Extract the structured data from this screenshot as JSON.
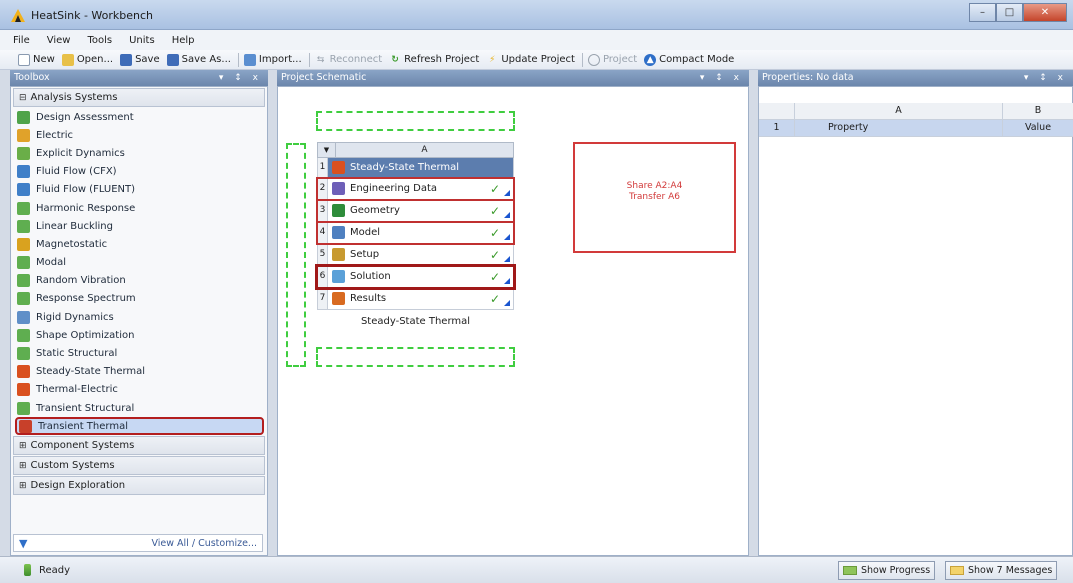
{
  "window": {
    "title": "HeatSink - Workbench"
  },
  "menu": [
    "File",
    "View",
    "Tools",
    "Units",
    "Help"
  ],
  "toolbar": {
    "new": "New",
    "open": "Open...",
    "save": "Save",
    "save_as": "Save As...",
    "import": "Import...",
    "reconnect": "Reconnect",
    "refresh": "Refresh Project",
    "update": "Update Project",
    "project": "Project",
    "compact": "Compact Mode"
  },
  "toolbox": {
    "title": "Toolbox",
    "controls": "▾ ↕ x",
    "analysis_header": "Analysis Systems",
    "items": [
      {
        "label": "Design Assessment",
        "color": "#4fa34a"
      },
      {
        "label": "Electric",
        "color": "#e0a22a"
      },
      {
        "label": "Explicit Dynamics",
        "color": "#6aae48"
      },
      {
        "label": "Fluid Flow (CFX)",
        "color": "#3f7fc8"
      },
      {
        "label": "Fluid Flow (FLUENT)",
        "color": "#3f7fc8"
      },
      {
        "label": "Harmonic Response",
        "color": "#5fae50"
      },
      {
        "label": "Linear Buckling",
        "color": "#5fae50"
      },
      {
        "label": "Magnetostatic",
        "color": "#d9a21f"
      },
      {
        "label": "Modal",
        "color": "#5fae50"
      },
      {
        "label": "Random Vibration",
        "color": "#5fae50"
      },
      {
        "label": "Response Spectrum",
        "color": "#5fae50"
      },
      {
        "label": "Rigid Dynamics",
        "color": "#5f8fc8"
      },
      {
        "label": "Shape Optimization",
        "color": "#5fae50"
      },
      {
        "label": "Static Structural",
        "color": "#5fae50"
      },
      {
        "label": "Steady-State Thermal",
        "color": "#d9501f"
      },
      {
        "label": "Thermal-Electric",
        "color": "#d9501f"
      },
      {
        "label": "Transient Structural",
        "color": "#5fae50"
      },
      {
        "label": "Transient Thermal",
        "color": "#c8402a"
      }
    ],
    "sections": [
      "Component Systems",
      "Custom Systems",
      "Design Exploration"
    ],
    "view_all": "View All / Customize..."
  },
  "schematic": {
    "title": "Project Schematic",
    "column": "A",
    "system_title": "Steady-State Thermal",
    "rows": [
      {
        "num": "2",
        "label": "Engineering Data",
        "color": "#6e5fb8"
      },
      {
        "num": "3",
        "label": "Geometry",
        "color": "#2e8c3a"
      },
      {
        "num": "4",
        "label": "Model",
        "color": "#4f80c0"
      },
      {
        "num": "5",
        "label": "Setup",
        "color": "#c89a30"
      },
      {
        "num": "6",
        "label": "Solution",
        "color": "#5aa0d8"
      },
      {
        "num": "7",
        "label": "Results",
        "color": "#d86a20"
      }
    ],
    "header_num": "1",
    "caption": "Steady-State Thermal",
    "note_line1": "Share A2:A4",
    "note_line2": "Transfer A6"
  },
  "properties": {
    "title": "Properties: No data",
    "col_a": "A",
    "col_b": "B",
    "row_num": "1",
    "row_prop": "Property",
    "row_val": "Value"
  },
  "status": {
    "text": "Ready",
    "progress": "Show Progress",
    "messages": "Show 7 Messages"
  }
}
